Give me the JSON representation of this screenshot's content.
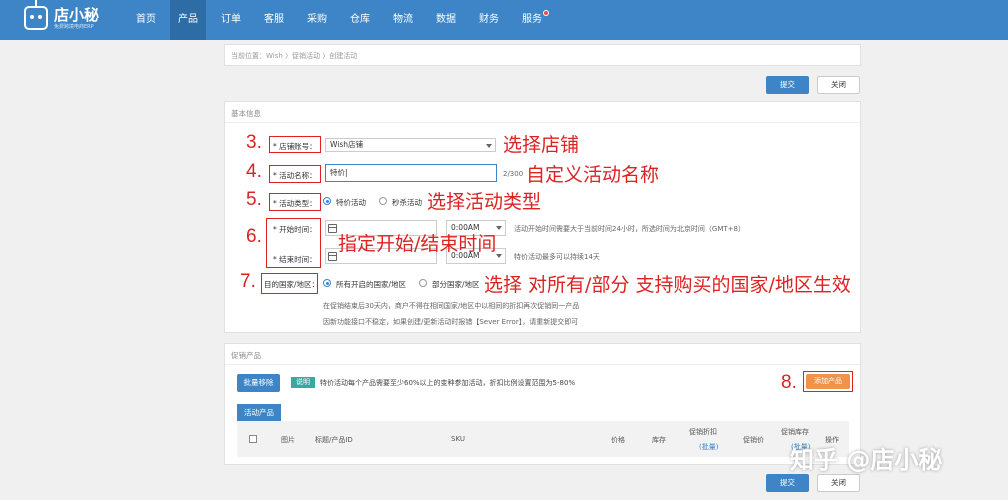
{
  "brand": {
    "name": "店小秘",
    "subtitle": "免费跨境电商ERP"
  },
  "nav": [
    {
      "label": "首页"
    },
    {
      "label": "产品"
    },
    {
      "label": "订单"
    },
    {
      "label": "客服"
    },
    {
      "label": "采购"
    },
    {
      "label": "仓库"
    },
    {
      "label": "物流"
    },
    {
      "label": "数据"
    },
    {
      "label": "财务"
    },
    {
      "label": "服务"
    }
  ],
  "breadcrumb": "当前位置：Wish 〉促销活动 〉创建活动",
  "actions": {
    "submit": "提交",
    "close": "关闭"
  },
  "basic_info": {
    "title": "基本信息",
    "store": {
      "label": "* 店铺账号：",
      "value": "Wish店铺"
    },
    "name": {
      "label": "* 活动名称：",
      "value": "特价|",
      "counter": "2/300"
    },
    "type": {
      "label": "* 活动类型：",
      "opt1": "特价活动",
      "opt2": "秒杀活动"
    },
    "start": {
      "label": "* 开始时间：",
      "time": "0:00AM",
      "hint": "活动开始时间需要大于当前时间24小时，所选时间为北京时间（GMT+8）"
    },
    "end": {
      "label": "* 结束时间：",
      "time": "0:00AM",
      "hint": "特价活动最多可以持续14天"
    },
    "region": {
      "label": "目的国家/地区：",
      "opt1": "所有开启的国家/地区",
      "opt2": "部分国家/地区"
    },
    "notes": [
      "在促销结束后30天内，商户不得在相同国家/地区中以相同的折扣再次促销同一产品",
      "因新功能接口不稳定，如果创建/更新活动时报错【Sever Error】，请重新提交即可"
    ]
  },
  "annotations": [
    {
      "num": "3.",
      "text": "选择店铺"
    },
    {
      "num": "4.",
      "text": "自定义活动名称"
    },
    {
      "num": "5.",
      "text": "选择活动类型"
    },
    {
      "num": "6.",
      "text": "指定开始/结束时间"
    },
    {
      "num": "7.",
      "text": "选择 对所有/部分 支持购买的国家/地区生效"
    },
    {
      "num": "8.",
      "text": ""
    }
  ],
  "promo": {
    "title": "促销产品",
    "batch_remove": "批量移除",
    "note_badge": "说明",
    "note_text": "特价活动每个产品需要至少60%以上的变种参加活动，折扣比例设置范围为5-80%",
    "add_product": "添加产品",
    "tab": "活动产品",
    "columns": {
      "image": "图片",
      "title": "标题/产品ID",
      "sku": "SKU",
      "price": "价格",
      "stock": "库存",
      "discount": "促销折扣",
      "discount_batch": "(批量)",
      "promo_price": "促销价",
      "promo_stock": "促销库存",
      "promo_stock_batch": "(批量)",
      "ops": "操作"
    }
  },
  "watermark": "知乎 @店小秘",
  "colors": {
    "nav": "#3d85c6",
    "annotation": "#dd2222",
    "add_button": "#f0924a"
  }
}
